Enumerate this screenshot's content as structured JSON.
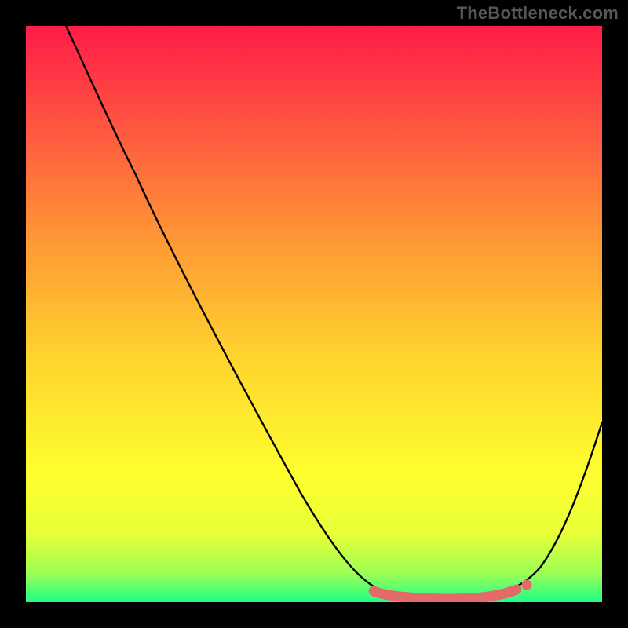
{
  "attribution": "TheBottleneck.com",
  "chart_data": {
    "type": "line",
    "title": "",
    "xlabel": "",
    "ylabel": "",
    "xlim": [
      0,
      100
    ],
    "ylim": [
      0,
      100
    ],
    "series": [
      {
        "name": "bottleneck-curve",
        "x": [
          7,
          12,
          18,
          25,
          32,
          40,
          48,
          55,
          60,
          63,
          66,
          70,
          74,
          78,
          82,
          86,
          90,
          94,
          100
        ],
        "y": [
          100,
          92,
          81,
          68,
          55,
          40,
          25,
          12,
          5,
          2,
          1,
          0.5,
          0.5,
          1,
          3,
          8,
          16,
          26,
          44
        ]
      }
    ],
    "highlight": {
      "name": "optimal-zone",
      "x_range": [
        60,
        85
      ],
      "y": 1,
      "color": "#e46a6a"
    },
    "background_gradient": {
      "top": "#ff1b49",
      "bottom": "#1eff87",
      "stops": [
        "#ff1b49",
        "#ff5e3f",
        "#ff9a34",
        "#ffd52e",
        "#feff2e",
        "#e8ff38",
        "#9dff54",
        "#1eff87"
      ]
    }
  }
}
